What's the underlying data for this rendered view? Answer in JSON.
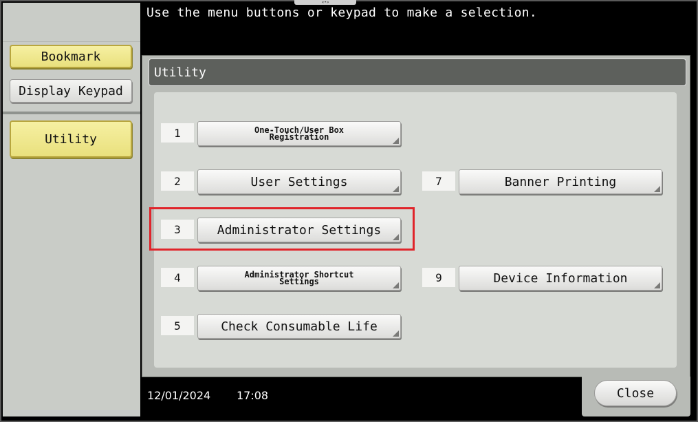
{
  "message": "Use the menu buttons or keypad to make a selection.",
  "sidebar": {
    "bookmark_label": "Bookmark",
    "display_keypad_label": "Display Keypad",
    "utility_label": "Utility"
  },
  "panel": {
    "title": "Utility",
    "items": [
      {
        "number": "1",
        "label_line1": "One-Touch/User Box",
        "label_line2": "Registration"
      },
      {
        "number": "2",
        "label": "User Settings"
      },
      {
        "number": "3",
        "label": "Administrator Settings"
      },
      {
        "number": "4",
        "label_line1": "Administrator Shortcut",
        "label_line2": "Settings"
      },
      {
        "number": "5",
        "label": "Check Consumable Life"
      },
      {
        "number": "7",
        "label": "Banner Printing"
      },
      {
        "number": "9",
        "label": "Device Information"
      }
    ]
  },
  "status": {
    "date": "12/01/2024",
    "time": "17:08"
  },
  "close_label": "Close",
  "colors": {
    "highlight": "#e0242a",
    "accent_yellow": "#e9e07d"
  }
}
